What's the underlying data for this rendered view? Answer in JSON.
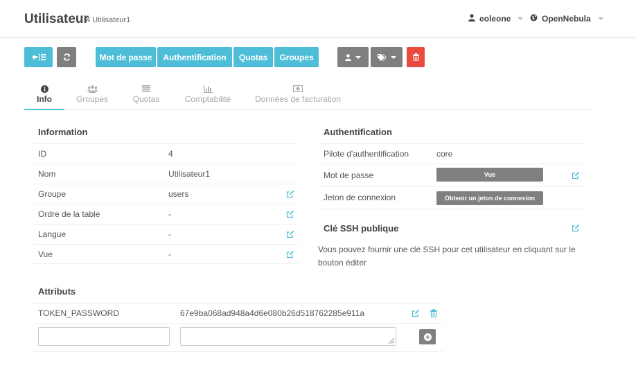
{
  "header": {
    "title": "Utilisateur",
    "subtitle": "4 Utilisateur1",
    "user_name": "eoleone",
    "zone_name": "OpenNebula"
  },
  "toolbar": {
    "password_label": "Mot de passe",
    "auth_label": "Authentification",
    "quotas_label": "Quotas",
    "groups_label": "Groupes"
  },
  "tabs": [
    {
      "label": "Info",
      "icon": "info-circle-icon",
      "active": true
    },
    {
      "label": "Groupes",
      "icon": "users-icon",
      "active": false
    },
    {
      "label": "Quotas",
      "icon": "align-justify-icon",
      "active": false
    },
    {
      "label": "Comptabilité",
      "icon": "bar-chart-icon",
      "active": false
    },
    {
      "label": "Données de facturation",
      "icon": "money-icon",
      "active": false
    }
  ],
  "information": {
    "title": "Information",
    "rows": [
      {
        "key": "ID",
        "value": "4"
      },
      {
        "key": "Nom",
        "value": "Utilisateur1"
      },
      {
        "key": "Groupe",
        "value": "users"
      },
      {
        "key": "Ordre de la table",
        "value": "-"
      },
      {
        "key": "Langue",
        "value": "-"
      },
      {
        "key": "Vue",
        "value": "-"
      }
    ]
  },
  "authentication": {
    "title": "Authentification",
    "driver_label": "Pilote d'authentification",
    "driver_value": "core",
    "password_label": "Mot de passe",
    "password_button": "Vue",
    "token_label": "Jeton de connexion",
    "token_button": "Obtenir un jeton de connexion"
  },
  "ssh": {
    "title": "Clé SSH publique",
    "text": "Vous pouvez fournir une clé SSH pour cet utilisateur en cliquant sur le bouton éditer"
  },
  "attributes": {
    "title": "Attributs",
    "rows": [
      {
        "key": "TOKEN_PASSWORD",
        "value": "67e9ba068ad948a4d6e080b26d518762285e911a"
      }
    ],
    "new_key_value": "",
    "new_value_value": ""
  },
  "colors": {
    "accent": "#4ebed8",
    "gray_button": "#7f7f7f",
    "danger": "#e74c3c"
  }
}
